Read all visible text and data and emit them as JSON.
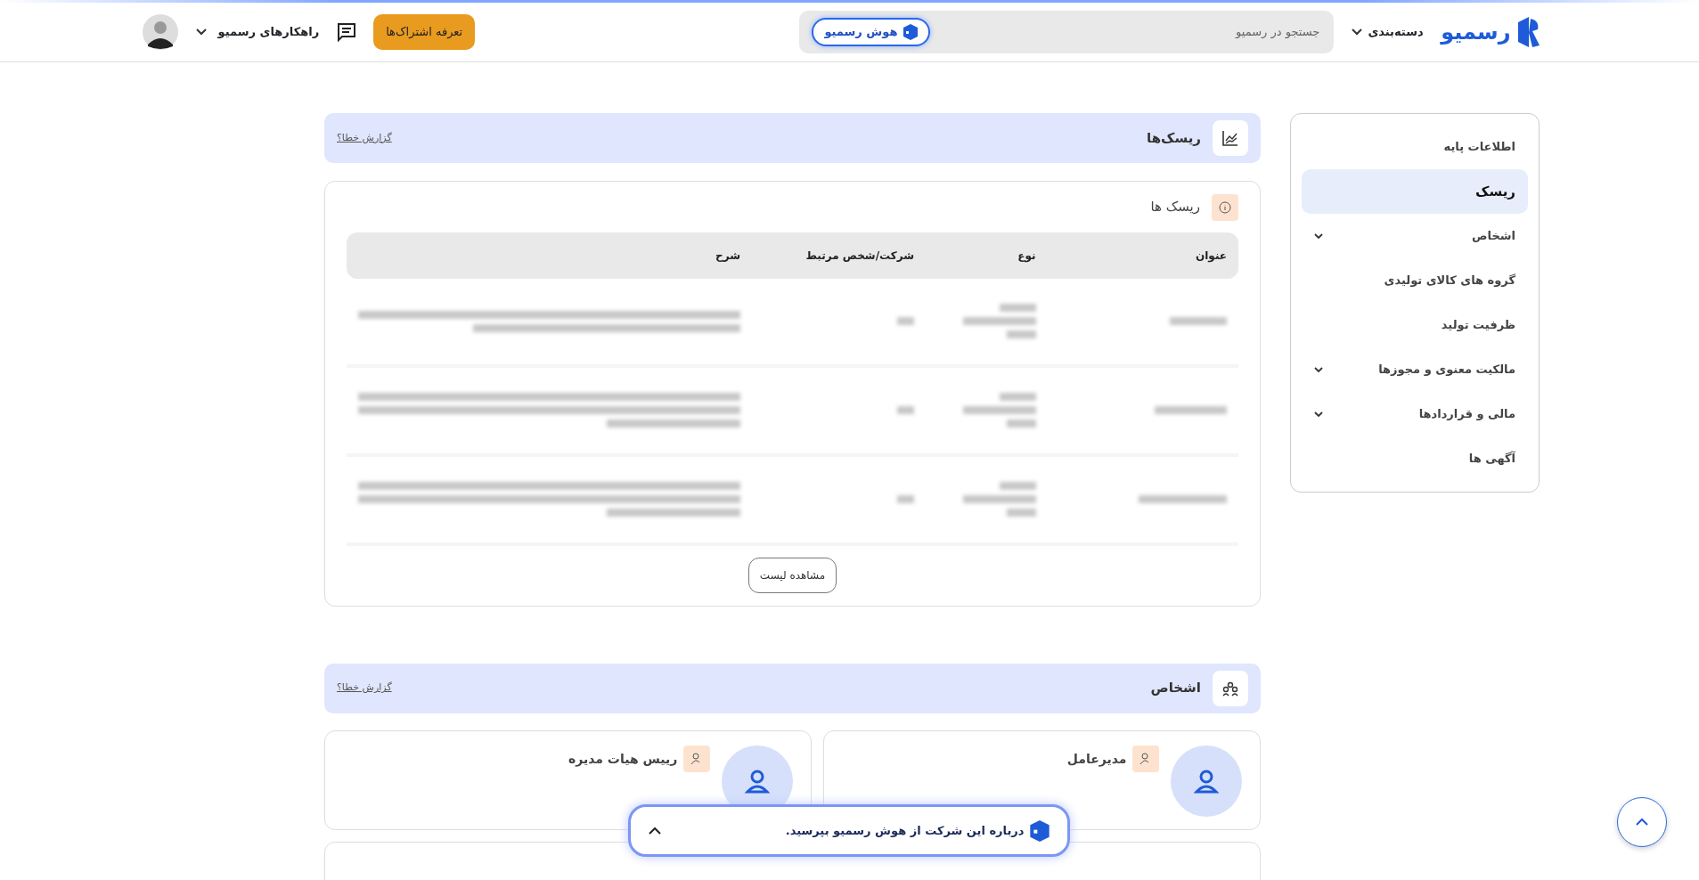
{
  "header": {
    "logo": "رسمیو",
    "categories": "دسته‌بندی",
    "search": {
      "placeholder": "جستجو در رسمیو"
    },
    "ai_button": "هوش رسمیو",
    "subscription_button": "تعرفه اشتراک‌ها",
    "solutions_menu": "راهکارهای رسمیو"
  },
  "sidebar": {
    "items": [
      {
        "label": "اطلاعات پایه",
        "selected": false,
        "expandable": false
      },
      {
        "label": "ریسک",
        "selected": true,
        "expandable": false
      },
      {
        "label": "اشخاص",
        "selected": false,
        "expandable": true
      },
      {
        "label": "گروه های کالای تولیدی",
        "selected": false,
        "expandable": false
      },
      {
        "label": "ظرفیت تولید",
        "selected": false,
        "expandable": false
      },
      {
        "label": "مالکیت معنوی و مجوزها",
        "selected": false,
        "expandable": true
      },
      {
        "label": "مالی و قراردادها",
        "selected": false,
        "expandable": true
      },
      {
        "label": "آگهی ها",
        "selected": false,
        "expandable": false
      }
    ]
  },
  "risks_section": {
    "title": "ریسک‌ها",
    "report_link": "گزارش خطا؟",
    "card": {
      "title": "ریسک ها",
      "table": {
        "columns": [
          "عنوان",
          "نوع",
          "شرکت/شخص مرتبط",
          "شرح"
        ],
        "rows": [
          {
            "kind": "blurred"
          },
          {
            "kind": "blurred"
          },
          {
            "kind": "blurred"
          }
        ]
      },
      "view_list_button": "مشاهده لیست"
    }
  },
  "persons_section": {
    "title": "اشخاص",
    "report_link": "گزارش خطا؟",
    "cards": [
      {
        "role": "مدیرعامل"
      },
      {
        "role": "رییس هیات مدیره"
      }
    ]
  },
  "ai_prompt": {
    "text": "درباره این شرکت از هوش رسمیو بپرسید."
  }
}
